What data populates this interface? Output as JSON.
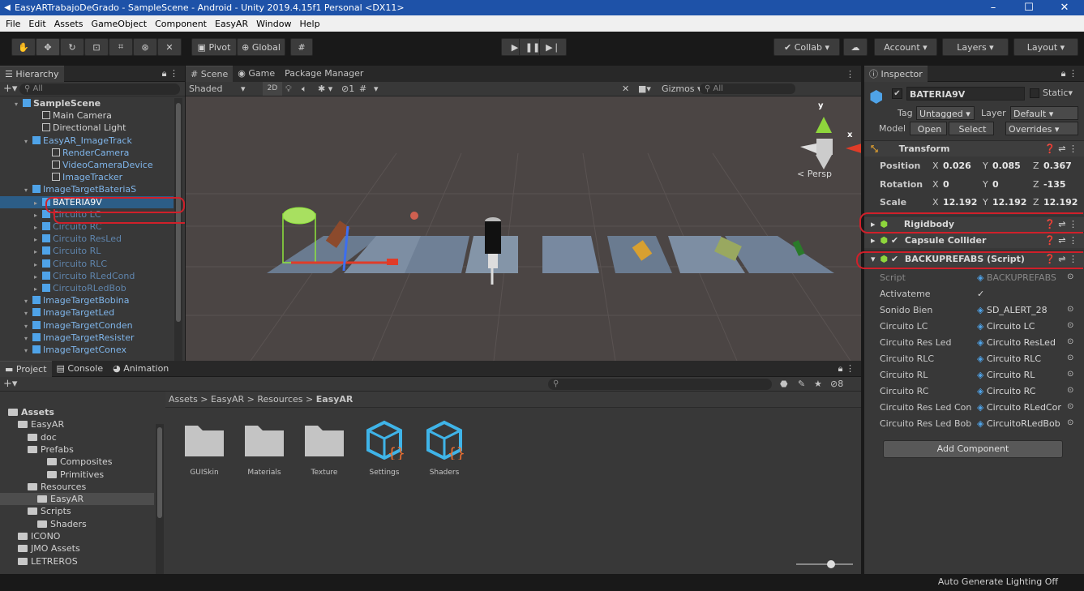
{
  "window": {
    "title": "EasyARTrabajoDeGrado - SampleScene - Android - Unity 2019.4.15f1 Personal <DX11>",
    "min": "–",
    "max": "☐",
    "close": "✕"
  },
  "menu": [
    "File",
    "Edit",
    "Assets",
    "GameObject",
    "Component",
    "EasyAR",
    "Window",
    "Help"
  ],
  "toolbar": {
    "pivot": "Pivot",
    "global": "Global",
    "collab": "Collab ▾",
    "account": "Account",
    "layers": "Layers",
    "layout": "Layout"
  },
  "hierarchy": {
    "title": "Hierarchy",
    "search": "All",
    "rows": [
      {
        "label": "SampleScene",
        "indent": 1,
        "kind": "scene"
      },
      {
        "label": "Main Camera",
        "indent": 3,
        "kind": "obj"
      },
      {
        "label": "Directional Light",
        "indent": 3,
        "kind": "obj"
      },
      {
        "label": "EasyAR_ImageTrack",
        "indent": 2,
        "kind": "prefab"
      },
      {
        "label": "RenderCamera",
        "indent": 4,
        "kind": "objp"
      },
      {
        "label": "VideoCameraDevice",
        "indent": 4,
        "kind": "objp"
      },
      {
        "label": "ImageTracker",
        "indent": 4,
        "kind": "objp"
      },
      {
        "label": "ImageTargetBateriaS",
        "indent": 2,
        "kind": "prefab"
      },
      {
        "label": "BATERIA9V",
        "indent": 3,
        "kind": "sel"
      },
      {
        "label": "Circuito LC",
        "indent": 3,
        "kind": "dim"
      },
      {
        "label": "Circuito RC",
        "indent": 3,
        "kind": "dim"
      },
      {
        "label": "Circuito ResLed",
        "indent": 3,
        "kind": "dim"
      },
      {
        "label": "Circuito RL",
        "indent": 3,
        "kind": "dim"
      },
      {
        "label": "Circuito RLC",
        "indent": 3,
        "kind": "dim"
      },
      {
        "label": "Circuito RLedCond",
        "indent": 3,
        "kind": "dim"
      },
      {
        "label": "CircuitoRLedBob",
        "indent": 3,
        "kind": "dim"
      },
      {
        "label": "ImageTargetBobina",
        "indent": 2,
        "kind": "prefab"
      },
      {
        "label": "ImageTargetLed",
        "indent": 2,
        "kind": "prefab"
      },
      {
        "label": "ImageTargetConden",
        "indent": 2,
        "kind": "prefab"
      },
      {
        "label": "ImageTargetResister",
        "indent": 2,
        "kind": "prefab"
      },
      {
        "label": "ImageTargetConex",
        "indent": 2,
        "kind": "prefab"
      }
    ]
  },
  "scene": {
    "tab_scene": "Scene",
    "tab_game": "Game",
    "tab_pkg": "Package Manager",
    "shading": "Shaded",
    "mode2d": "2D",
    "gizmos": "Gizmos",
    "search": "All",
    "persp": "< Persp",
    "axis_y": "y",
    "axis_x": "x",
    "counter": "1"
  },
  "inspector": {
    "title": "Inspector",
    "object_name": "BATERIA9V",
    "static": "Static",
    "tag_label": "Tag",
    "tag": "Untagged",
    "layer_label": "Layer",
    "layer": "Default",
    "model_label": "Model",
    "open": "Open",
    "select": "Select",
    "overrides": "Overrides",
    "transform": "Transform",
    "position": {
      "label": "Position",
      "x": "0.026",
      "y": "0.085",
      "z": "0.367"
    },
    "rotation": {
      "label": "Rotation",
      "x": "0",
      "y": "0",
      "z": "-135"
    },
    "scale": {
      "label": "Scale",
      "x": "12.192",
      "y": "12.192",
      "z": "12.192"
    },
    "rigidbody": "Rigidbody",
    "capsule": "Capsule Collider",
    "backup": "BACKUPREFABS (Script)",
    "fields": [
      {
        "label": "Script",
        "value": "BACKUPREFABS"
      },
      {
        "label": "Activateme",
        "value": "✓"
      },
      {
        "label": "Sonido Bien",
        "value": "SD_ALERT_28"
      },
      {
        "label": "Circuito LC",
        "value": "Circuito LC"
      },
      {
        "label": "Circuito Res Led",
        "value": "Circuito ResLed"
      },
      {
        "label": "Circuito RLC",
        "value": "Circuito RLC"
      },
      {
        "label": "Circuito RL",
        "value": "Circuito RL"
      },
      {
        "label": "Circuito RC",
        "value": "Circuito RC"
      },
      {
        "label": "Circuito Res Led Con",
        "value": "Circuito RLedCor"
      },
      {
        "label": "Circuito Res Led Bob",
        "value": "CircuitoRLedBob"
      }
    ],
    "add_component": "Add Component"
  },
  "project": {
    "tab_project": "Project",
    "tab_console": "Console",
    "tab_anim": "Animation",
    "breadcrumb": [
      "Assets",
      "EasyAR",
      "Resources",
      "EasyAR"
    ],
    "hidden_count": "8",
    "tree": [
      {
        "label": "Assets",
        "indent": 0,
        "bold": true
      },
      {
        "label": "EasyAR",
        "indent": 1
      },
      {
        "label": "doc",
        "indent": 2
      },
      {
        "label": "Prefabs",
        "indent": 2
      },
      {
        "label": "Composites",
        "indent": 4
      },
      {
        "label": "Primitives",
        "indent": 4
      },
      {
        "label": "Resources",
        "indent": 2
      },
      {
        "label": "EasyAR",
        "indent": 3,
        "sel": true
      },
      {
        "label": "Scripts",
        "indent": 2
      },
      {
        "label": "Shaders",
        "indent": 3
      },
      {
        "label": "ICONO",
        "indent": 1
      },
      {
        "label": "JMO Assets",
        "indent": 1
      },
      {
        "label": "LETREROS",
        "indent": 1
      }
    ],
    "assets": [
      {
        "label": "GUISkin",
        "type": "folder"
      },
      {
        "label": "Materials",
        "type": "folder"
      },
      {
        "label": "Texture",
        "type": "folder"
      },
      {
        "label": "Settings",
        "type": "package"
      },
      {
        "label": "Shaders",
        "type": "package"
      }
    ]
  },
  "status": "Auto Generate Lighting Off",
  "colors": {
    "accent": "#1e52a8",
    "selection": "#2c5d87",
    "annotation": "#d0202a",
    "prefab": "#7fb5ea"
  }
}
